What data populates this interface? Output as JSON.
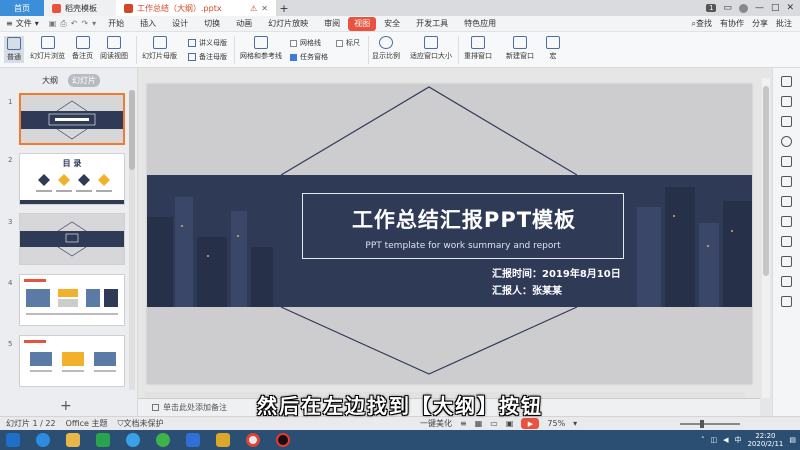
{
  "titlebar": {
    "tabs": [
      {
        "label": "首页"
      },
      {
        "label": "稻壳模板"
      },
      {
        "label": "工作总结（大纲）.pptx"
      }
    ],
    "badge": "1",
    "user_badge": "1"
  },
  "menubar": {
    "file": "文件",
    "items": [
      "开始",
      "插入",
      "设计",
      "切换",
      "动画",
      "幻灯片放映",
      "审阅",
      "视图",
      "安全",
      "开发工具",
      "特色应用"
    ],
    "active": "视图",
    "search": "查找",
    "right": [
      "有协作",
      "分享",
      "批注"
    ]
  },
  "ribbon": {
    "buttons": [
      "普通",
      "幻灯片浏览",
      "备注页",
      "阅读视图",
      "幻灯片母版",
      "讲义母版",
      "备注母版",
      "网格和参考线",
      "网格线",
      "标尺",
      "任务窗格",
      "显示比例",
      "适应窗口大小",
      "重排窗口",
      "新建窗口",
      "宏"
    ]
  },
  "leftpane": {
    "tab_outline": "大纲",
    "tab_slides": "幻灯片",
    "slide_numbers": [
      "1",
      "2",
      "3",
      "4",
      "5"
    ],
    "thumb2_title": "目 录",
    "add": "+"
  },
  "slide": {
    "title": "工作总结汇报PPT模板",
    "subtitle": "PPT template for work summary and report",
    "time": "汇报时间：2019年8月10日",
    "reporter": "汇报人：张某某"
  },
  "notes": {
    "placeholder": "单击此处添加备注"
  },
  "statusbar": {
    "slide_info": "幻灯片 1 / 22",
    "theme": "Office 主题",
    "protect": "文档未保护",
    "beautify": "一键美化",
    "zoom": "75%"
  },
  "caption": "然后在左边找到【大纲】按钮",
  "taskbar": {
    "time": "22:20",
    "date": "2020/2/11",
    "ime": "中"
  },
  "colors": {
    "accent": "#e8533f",
    "band": "#2f3a57",
    "selection": "#f07a2e"
  }
}
